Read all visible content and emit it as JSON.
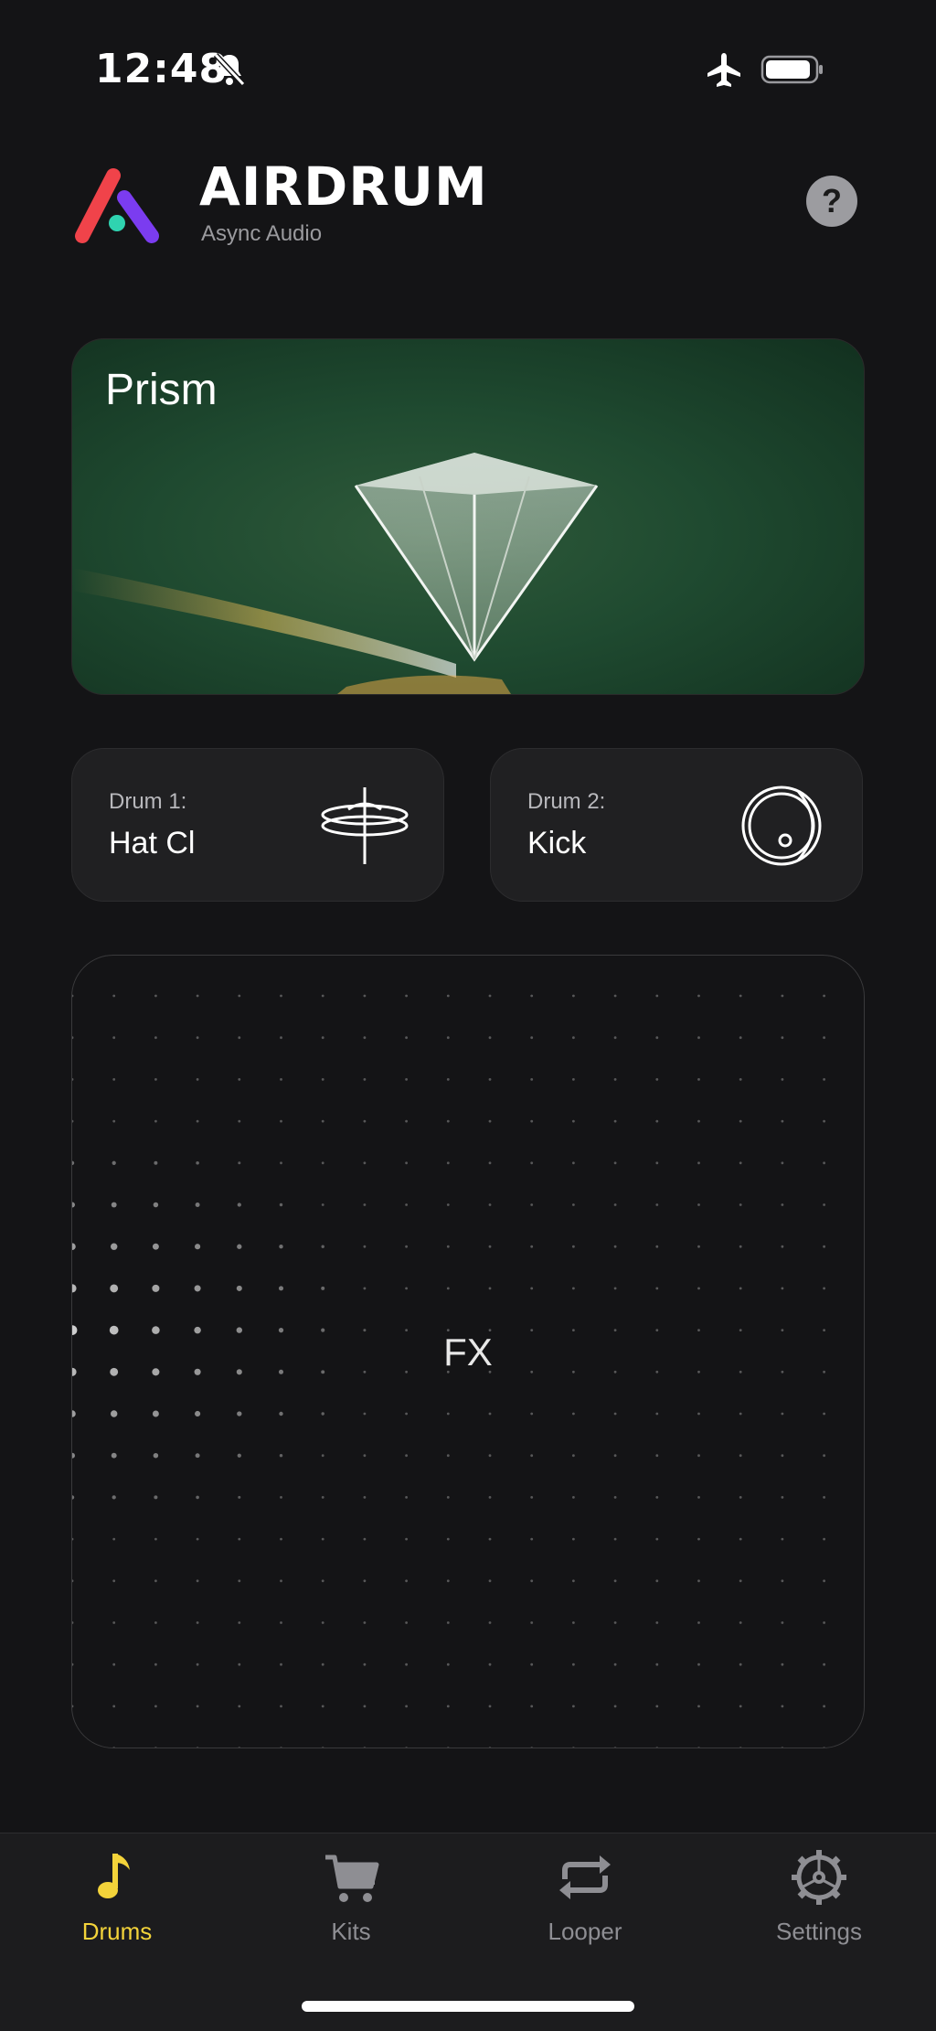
{
  "status_bar": {
    "time": "12:48"
  },
  "header": {
    "title": "AIRDRUM",
    "subtitle": "Async Audio",
    "help_label": "?"
  },
  "kit": {
    "name": "Prism"
  },
  "pads": [
    {
      "label": "Drum 1:",
      "value": "Hat Cl",
      "icon": "hi-hat-icon"
    },
    {
      "label": "Drum 2:",
      "value": "Kick",
      "icon": "kick-drum-icon"
    }
  ],
  "fx": {
    "label": "FX"
  },
  "tabs": [
    {
      "label": "Drums",
      "icon": "music-note-icon",
      "active": true
    },
    {
      "label": "Kits",
      "icon": "cart-icon",
      "active": false
    },
    {
      "label": "Looper",
      "icon": "repeat-icon",
      "active": false
    },
    {
      "label": "Settings",
      "icon": "gear-icon",
      "active": false
    }
  ],
  "colors": {
    "accent": "#f3d33a",
    "background": "#141416",
    "kit_card": "#1f4a30"
  }
}
